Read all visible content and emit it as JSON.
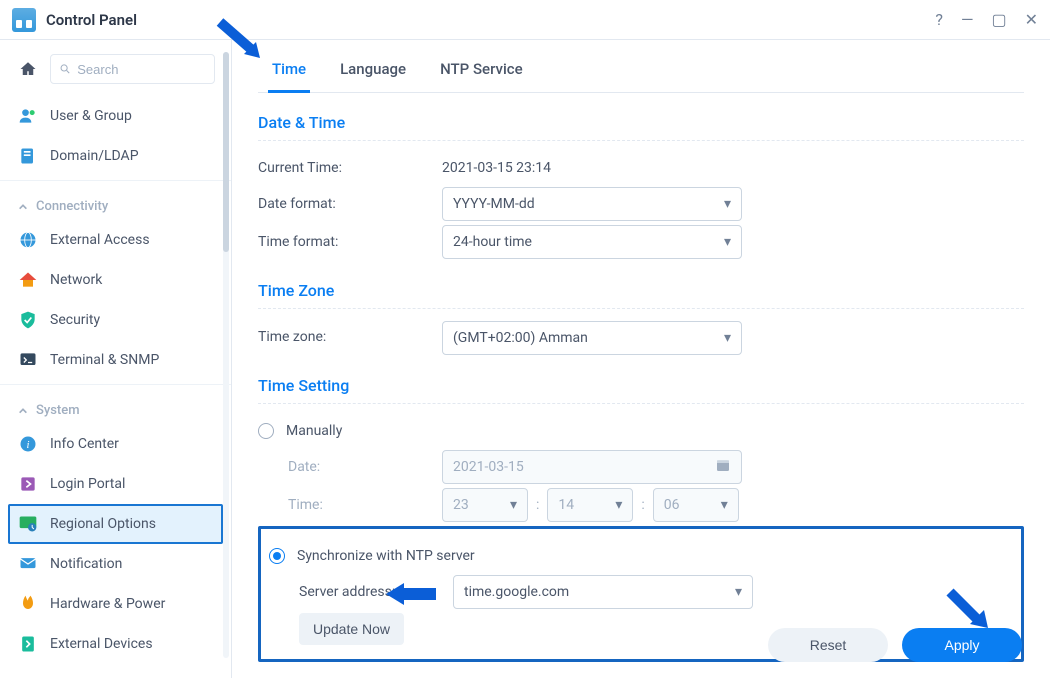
{
  "titlebar": {
    "title": "Control Panel",
    "window_controls": {
      "help": "?",
      "minimize": "—",
      "maximize": "▢",
      "close": "✕"
    }
  },
  "sidebar": {
    "search_placeholder": "Search",
    "items_top": [
      {
        "label": "User & Group"
      },
      {
        "label": "Domain/LDAP"
      }
    ],
    "groups": [
      {
        "header": "Connectivity",
        "items": [
          {
            "label": "External Access"
          },
          {
            "label": "Network"
          },
          {
            "label": "Security"
          },
          {
            "label": "Terminal & SNMP"
          }
        ]
      },
      {
        "header": "System",
        "items": [
          {
            "label": "Info Center"
          },
          {
            "label": "Login Portal"
          },
          {
            "label": "Regional Options",
            "active": true
          },
          {
            "label": "Notification"
          },
          {
            "label": "Hardware & Power"
          },
          {
            "label": "External Devices"
          }
        ]
      }
    ]
  },
  "tabs": {
    "time": "Time",
    "language": "Language",
    "ntp_service": "NTP Service"
  },
  "sections": {
    "date_time": "Date & Time",
    "time_zone": "Time Zone",
    "time_setting": "Time Setting"
  },
  "labels": {
    "current_time": "Current Time:",
    "date_format": "Date format:",
    "time_format": "Time format:",
    "time_zone": "Time zone:",
    "manually": "Manually",
    "date": "Date:",
    "time": "Time:",
    "sync_ntp": "Synchronize with NTP server",
    "server_address": "Server address:",
    "update_now": "Update Now",
    "reset": "Reset",
    "apply": "Apply"
  },
  "values": {
    "current_time": "2021-03-15 23:14",
    "date_format": "YYYY-MM-dd",
    "time_format": "24-hour time",
    "time_zone": "(GMT+02:00) Amman",
    "manual_date": "2021-03-15",
    "manual_hour": "23",
    "manual_minute": "14",
    "manual_second": "06",
    "server_address": "time.google.com"
  },
  "accent_color": "#0a7ef2",
  "highlight_border": "#1565c0"
}
